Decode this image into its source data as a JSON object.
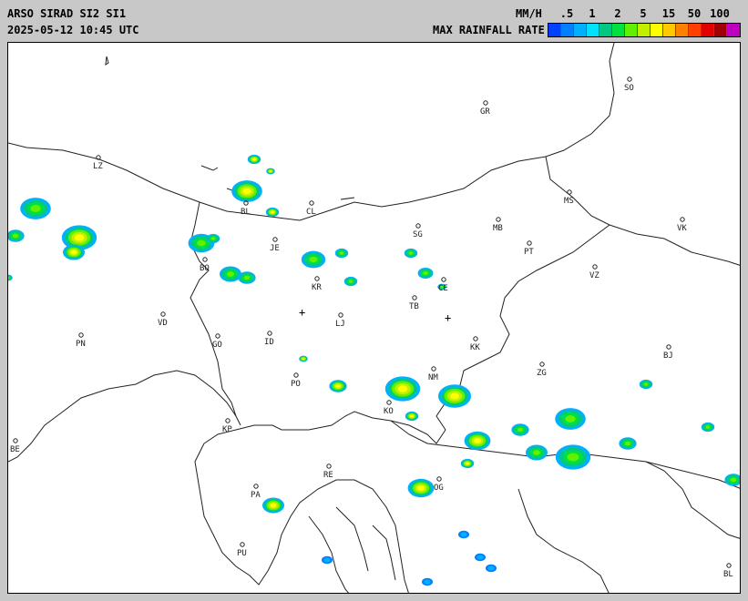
{
  "header": {
    "title": "ARSO SIRAD SI2 SI1",
    "timestamp": "2025-05-12 10:45 UTC",
    "unit": "MM/H",
    "legend_title": "MAX RAINFALL RATE"
  },
  "legend": {
    "tick_labels": [
      ".5",
      "1",
      "2",
      "5",
      "15",
      "50",
      "100"
    ],
    "colors": [
      "#0040ff",
      "#0080ff",
      "#00b0ff",
      "#00e0ff",
      "#00c880",
      "#00e040",
      "#60f000",
      "#c0f000",
      "#ffff00",
      "#ffc800",
      "#ff8000",
      "#ff4000",
      "#e00000",
      "#a00000",
      "#c000c0"
    ]
  },
  "map": {
    "colors": {
      "background": "#ffffff",
      "frame": "#c8c8c8",
      "border_line": "#222222",
      "town": "#222222"
    },
    "markers": [
      "crosshair-icon",
      "crosshair-icon"
    ],
    "towns": [
      {
        "code": "SO"
      },
      {
        "code": "GR"
      },
      {
        "code": "LZ"
      },
      {
        "code": "BL"
      },
      {
        "code": "CL"
      },
      {
        "code": "MS"
      },
      {
        "code": "MB"
      },
      {
        "code": "SG"
      },
      {
        "code": "JE"
      },
      {
        "code": "PT"
      },
      {
        "code": "VK"
      },
      {
        "code": "BO"
      },
      {
        "code": "KR"
      },
      {
        "code": "CE"
      },
      {
        "code": "VZ"
      },
      {
        "code": "TB"
      },
      {
        "code": "VD"
      },
      {
        "code": "LJ"
      },
      {
        "code": "PN"
      },
      {
        "code": "ID"
      },
      {
        "code": "GO"
      },
      {
        "code": "KK"
      },
      {
        "code": "BJ"
      },
      {
        "code": "NM"
      },
      {
        "code": "ZG"
      },
      {
        "code": "PO"
      },
      {
        "code": "KO"
      },
      {
        "code": "KP"
      },
      {
        "code": "RE"
      },
      {
        "code": "OG"
      },
      {
        "code": "PA"
      },
      {
        "code": "PU"
      },
      {
        "code": "BE"
      },
      {
        "code": "BL"
      }
    ],
    "rain_cells": [
      {
        "id": "lz-west-1",
        "intensity": "moderate"
      },
      {
        "id": "lz-west-2",
        "intensity": "heavy"
      },
      {
        "id": "bl-north",
        "intensity": "heavy"
      },
      {
        "id": "bo-cluster",
        "intensity": "moderate"
      },
      {
        "id": "kr-cluster",
        "intensity": "moderate"
      },
      {
        "id": "sg-ce",
        "intensity": "moderate"
      },
      {
        "id": "po-cell",
        "intensity": "heavy"
      },
      {
        "id": "ko-nm-cluster",
        "intensity": "heavy"
      },
      {
        "id": "zg-south-band",
        "intensity": "moderate"
      },
      {
        "id": "og-cell",
        "intensity": "heavy"
      },
      {
        "id": "pa-cell",
        "intensity": "heavy"
      },
      {
        "id": "pu-south",
        "intensity": "light"
      }
    ]
  }
}
